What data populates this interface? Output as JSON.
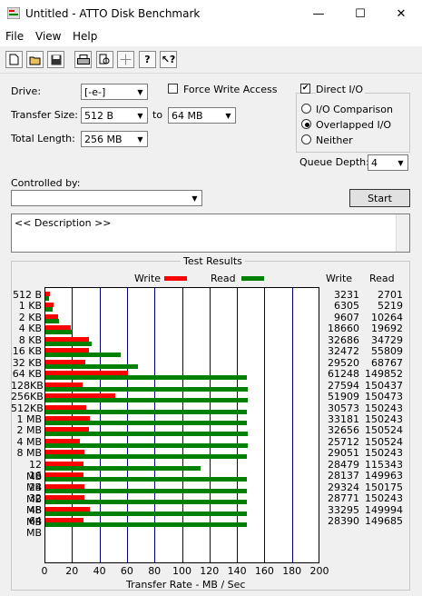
{
  "window": {
    "title": "Untitled - ATTO Disk Benchmark",
    "minimize": "—",
    "maximize": "☐",
    "close": "✕"
  },
  "menu": {
    "file": "File",
    "view": "View",
    "help": "Help"
  },
  "toolbar": [
    "new-icon",
    "open-icon",
    "save-icon",
    "print-icon",
    "print-preview-icon",
    "move-icon",
    "help-icon",
    "context-help-icon"
  ],
  "form": {
    "drive_label": "Drive:",
    "drive_value": "[-e-]",
    "transfer_size_label": "Transfer Size:",
    "transfer_from": "512 B",
    "to_label": "to",
    "transfer_to": "64 MB",
    "total_length_label": "Total Length:",
    "total_length_value": "256 MB",
    "force_write_label": "Force Write Access",
    "force_write_checked": false,
    "direct_io_label": "Direct I/O",
    "direct_io_checked": true,
    "io_comparison_label": "I/O Comparison",
    "overlapped_io_label": "Overlapped I/O",
    "neither_label": "Neither",
    "selected_mode": "Overlapped I/O",
    "queue_depth_label": "Queue Depth:",
    "queue_depth_value": "4",
    "controlled_by_label": "Controlled by:",
    "controlled_by_value": "",
    "start_label": "Start",
    "description": "<< Description >>"
  },
  "results": {
    "group_title": "Test Results",
    "legend_write": "Write",
    "legend_read": "Read",
    "col_write": "Write",
    "col_read": "Read",
    "rows": [
      {
        "size": "512 B",
        "write": "3231",
        "read": "2701"
      },
      {
        "size": "1 KB",
        "write": "6305",
        "read": "5219"
      },
      {
        "size": "2 KB",
        "write": "9607",
        "read": "10264"
      },
      {
        "size": "4 KB",
        "write": "18660",
        "read": "19692"
      },
      {
        "size": "8 KB",
        "write": "32686",
        "read": "34729"
      },
      {
        "size": "16 KB",
        "write": "32472",
        "read": "55809"
      },
      {
        "size": "32 KB",
        "write": "29520",
        "read": "68767"
      },
      {
        "size": "64 KB",
        "write": "61248",
        "read": "149852"
      },
      {
        "size": "128KB",
        "write": "27594",
        "read": "150437"
      },
      {
        "size": "256KB",
        "write": "51909",
        "read": "150473"
      },
      {
        "size": "512KB",
        "write": "30573",
        "read": "150243"
      },
      {
        "size": "1 MB",
        "write": "33181",
        "read": "150243"
      },
      {
        "size": "2 MB",
        "write": "32656",
        "read": "150524"
      },
      {
        "size": "4 MB",
        "write": "25712",
        "read": "150524"
      },
      {
        "size": "8 MB",
        "write": "29051",
        "read": "150243"
      },
      {
        "size": "12 MB",
        "write": "28479",
        "read": "115343"
      },
      {
        "size": "16 MB",
        "write": "28137",
        "read": "149963"
      },
      {
        "size": "24 MB",
        "write": "29324",
        "read": "150175"
      },
      {
        "size": "32 MB",
        "write": "28771",
        "read": "150243"
      },
      {
        "size": "48 MB",
        "write": "33295",
        "read": "149994"
      },
      {
        "size": "64 MB",
        "write": "28390",
        "read": "149685"
      }
    ],
    "x_ticks": [
      "0",
      "20",
      "40",
      "60",
      "80",
      "100",
      "120",
      "140",
      "160",
      "180",
      "200"
    ],
    "x_axis_label": "Transfer Rate - MB / Sec",
    "colors": {
      "write": "#ff0000",
      "read": "#008000",
      "grid": "#000080"
    }
  },
  "chart_data": {
    "type": "bar",
    "categories": [
      "512 B",
      "1 KB",
      "2 KB",
      "4 KB",
      "8 KB",
      "16 KB",
      "32 KB",
      "64 KB",
      "128KB",
      "256KB",
      "512KB",
      "1 MB",
      "2 MB",
      "4 MB",
      "8 MB",
      "12 MB",
      "16 MB",
      "24 MB",
      "32 MB",
      "48 MB",
      "64 MB"
    ],
    "series": [
      {
        "name": "Write",
        "values": [
          3.155,
          6.157,
          9.382,
          18.223,
          31.92,
          31.711,
          28.828,
          59.813,
          26.947,
          50.692,
          29.856,
          32.403,
          31.891,
          25.109,
          28.37,
          27.812,
          27.478,
          28.637,
          28.097,
          32.515,
          27.725
        ]
      },
      {
        "name": "Read",
        "values": [
          2.638,
          5.097,
          10.023,
          19.23,
          33.915,
          54.501,
          67.155,
          146.34,
          146.911,
          146.946,
          146.722,
          146.722,
          146.996,
          146.996,
          146.722,
          112.64,
          146.448,
          146.655,
          146.722,
          146.479,
          146.177
        ]
      }
    ],
    "xlabel": "Transfer Rate - MB / Sec",
    "xlim": [
      0,
      200
    ],
    "grid": true,
    "legend": "top"
  }
}
